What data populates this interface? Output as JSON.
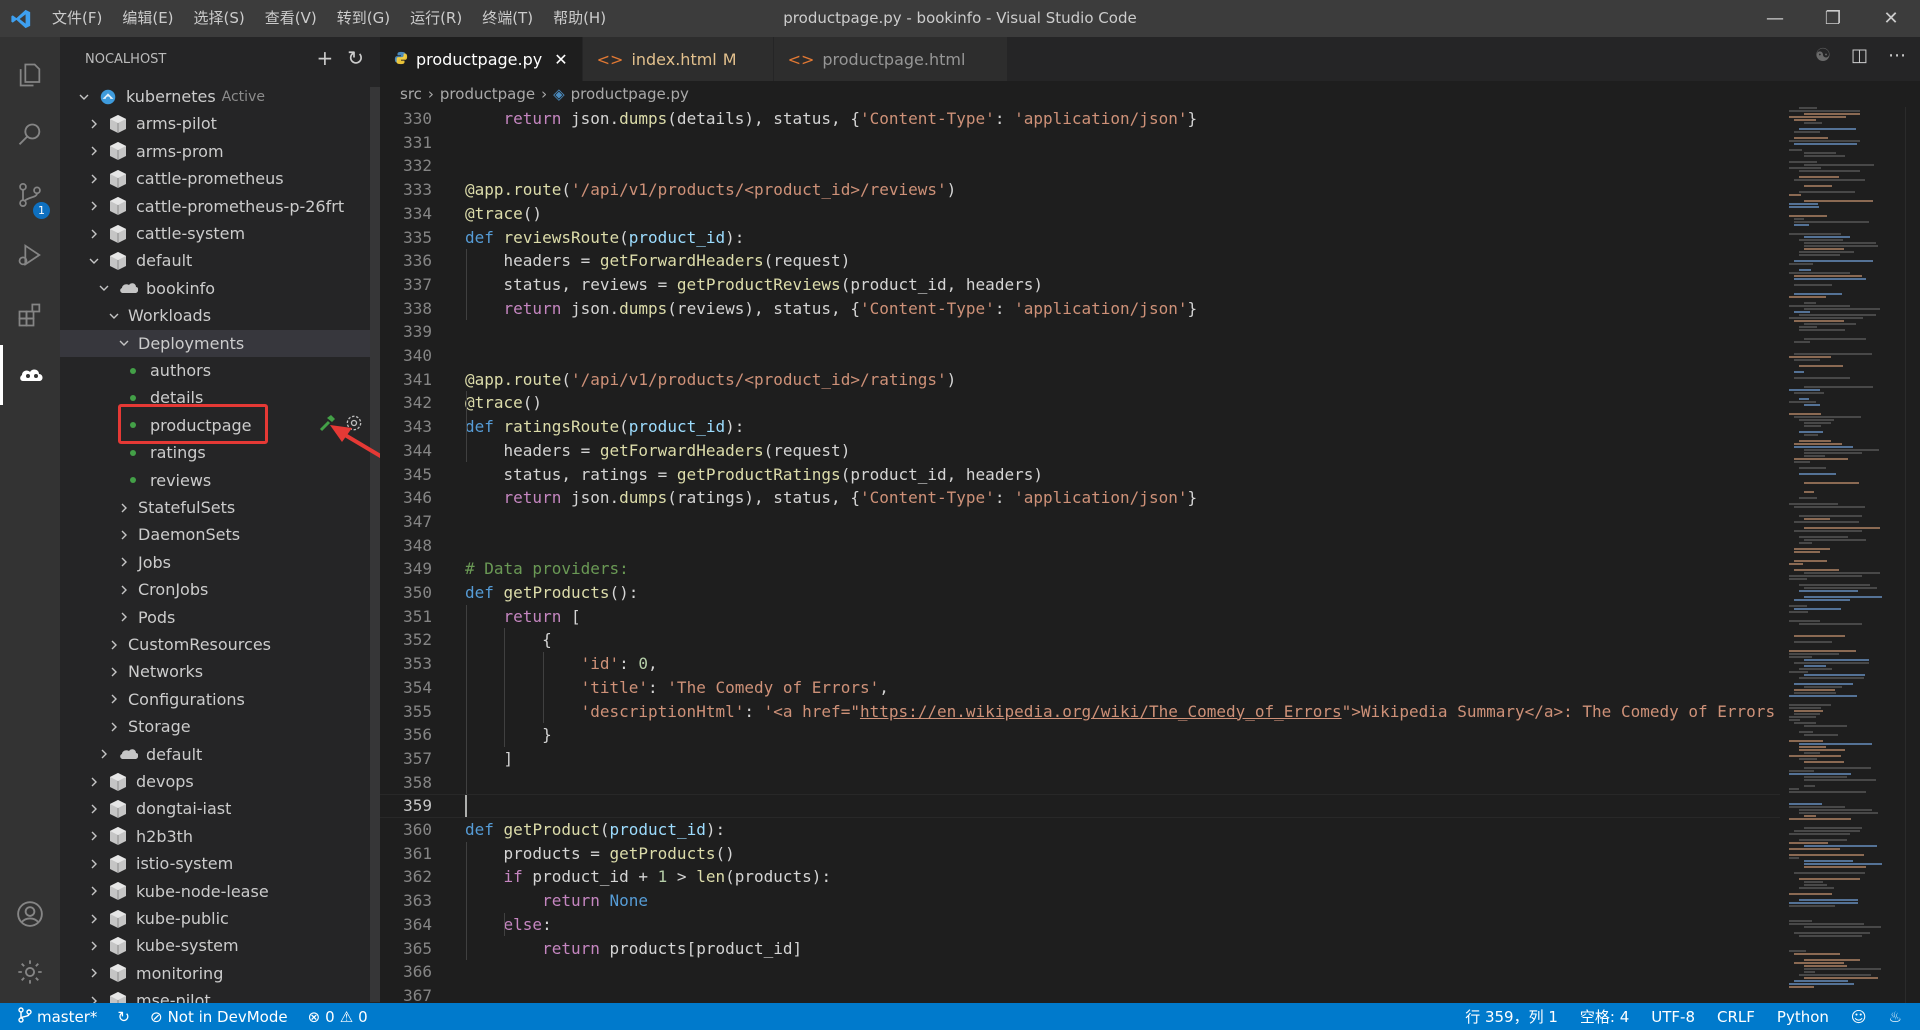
{
  "titlebar": {
    "menu": [
      "文件(F)",
      "编辑(E)",
      "选择(S)",
      "查看(V)",
      "转到(G)",
      "运行(R)",
      "终端(T)",
      "帮助(H)"
    ],
    "title": "productpage.py - bookinfo - Visual Studio Code"
  },
  "activity": {
    "scm_badge": "1"
  },
  "sidebar": {
    "header": "NOCALHOST",
    "tree": {
      "root_label": "kubernetes",
      "root_status": "Active",
      "namespaces_top": [
        "arms-pilot",
        "arms-prom",
        "cattle-prometheus",
        "cattle-prometheus-p-26frt",
        "cattle-system",
        "default"
      ],
      "app": "bookinfo",
      "workloads": "Workloads",
      "deployments": "Deployments",
      "deployment_items": [
        "authors",
        "details",
        "productpage",
        "ratings",
        "reviews"
      ],
      "workload_groups": [
        "StatefulSets",
        "DaemonSets",
        "Jobs",
        "CronJobs",
        "Pods"
      ],
      "resource_groups": [
        "CustomResources",
        "Networks",
        "Configurations",
        "Storage"
      ],
      "default_app": "default",
      "namespaces_bottom": [
        "devops",
        "dongtai-iast",
        "h2b3th",
        "istio-system",
        "kube-node-lease",
        "kube-public",
        "kube-system",
        "monitoring",
        "mse-pilot"
      ]
    }
  },
  "tabs": [
    {
      "label": "productpage.py",
      "status": "",
      "active": true
    },
    {
      "label": "index.html",
      "status": "M",
      "active": false
    },
    {
      "label": "productpage.html",
      "status": "",
      "active": false
    }
  ],
  "breadcrumb": [
    "src",
    "productpage",
    "productpage.py"
  ],
  "editor": {
    "current_line": 359,
    "lines": [
      {
        "n": "330",
        "html": "    <span class=\"kw2\">return</span> json.<span class=\"fn\">dumps</span>(details), status, {<span class=\"str\">'Content-Type'</span>: <span class=\"str\">'application/json'</span>}"
      },
      {
        "n": "331",
        "html": ""
      },
      {
        "n": "332",
        "html": ""
      },
      {
        "n": "333",
        "html": "<span class=\"dec\">@app.route</span>(<span class=\"str\">'/api/v1/products/&lt;product_id&gt;/reviews'</span>)"
      },
      {
        "n": "334",
        "html": "<span class=\"dec\">@trace</span>()"
      },
      {
        "n": "335",
        "html": "<span class=\"kw\">def</span> <span class=\"fn\">reviewsRoute</span>(<span class=\"var\">product_id</span>):"
      },
      {
        "n": "336",
        "html": "    headers = <span class=\"fn\">getForwardHeaders</span>(request)"
      },
      {
        "n": "337",
        "html": "    status, reviews = <span class=\"fn\">getProductReviews</span>(product_id, headers)"
      },
      {
        "n": "338",
        "html": "    <span class=\"kw2\">return</span> json.<span class=\"fn\">dumps</span>(reviews), status, {<span class=\"str\">'Content-Type'</span>: <span class=\"str\">'application/json'</span>}"
      },
      {
        "n": "339",
        "html": ""
      },
      {
        "n": "340",
        "html": ""
      },
      {
        "n": "341",
        "html": "<span class=\"dec\">@app.route</span>(<span class=\"str\">'/api/v1/products/&lt;product_id&gt;/ratings'</span>)"
      },
      {
        "n": "342",
        "html": "<span class=\"dec\">@trace</span>()"
      },
      {
        "n": "343",
        "html": "<span class=\"kw\">def</span> <span class=\"fn\">ratingsRoute</span>(<span class=\"var\">product_id</span>):"
      },
      {
        "n": "344",
        "html": "    headers = <span class=\"fn\">getForwardHeaders</span>(request)"
      },
      {
        "n": "345",
        "html": "    status, ratings = <span class=\"fn\">getProductRatings</span>(product_id, headers)"
      },
      {
        "n": "346",
        "html": "    <span class=\"kw2\">return</span> json.<span class=\"fn\">dumps</span>(ratings), status, {<span class=\"str\">'Content-Type'</span>: <span class=\"str\">'application/json'</span>}"
      },
      {
        "n": "347",
        "html": ""
      },
      {
        "n": "348",
        "html": ""
      },
      {
        "n": "349",
        "html": "<span class=\"cm\"># Data providers:</span>"
      },
      {
        "n": "350",
        "html": "<span class=\"kw\">def</span> <span class=\"fn\">getProducts</span>():"
      },
      {
        "n": "351",
        "html": "    <span class=\"kw2\">return</span> ["
      },
      {
        "n": "352",
        "html": "        {"
      },
      {
        "n": "353",
        "html": "            <span class=\"str\">'id'</span>: <span class=\"num\">0</span>,"
      },
      {
        "n": "354",
        "html": "            <span class=\"str\">'title'</span>: <span class=\"str\">'The Comedy of Errors'</span>,"
      },
      {
        "n": "355",
        "html": "            <span class=\"str\">'descriptionHtml'</span>: <span class=\"str\">'&lt;a href=\"<span class=\"url\">https://en.wikipedia.org/wiki/The_Comedy_of_Errors</span>\"&gt;Wikipedia Summary&lt;/a&gt;: The Comedy of Errors</span>"
      },
      {
        "n": "356",
        "html": "        }"
      },
      {
        "n": "357",
        "html": "    ]"
      },
      {
        "n": "358",
        "html": ""
      },
      {
        "n": "359",
        "html": ""
      },
      {
        "n": "360",
        "html": "<span class=\"kw\">def</span> <span class=\"fn\">getProduct</span>(<span class=\"var\">product_id</span>):"
      },
      {
        "n": "361",
        "html": "    products = <span class=\"fn\">getProducts</span>()"
      },
      {
        "n": "362",
        "html": "    <span class=\"kw2\">if</span> product_id + <span class=\"num\">1</span> &gt; <span class=\"fn\">len</span>(products):"
      },
      {
        "n": "363",
        "html": "        <span class=\"kw2\">return</span> <span class=\"kw\">None</span>"
      },
      {
        "n": "364",
        "html": "    <span class=\"kw2\">else</span>:"
      },
      {
        "n": "365",
        "html": "        <span class=\"kw2\">return</span> products[product_id]"
      },
      {
        "n": "366",
        "html": ""
      },
      {
        "n": "367",
        "html": ""
      }
    ]
  },
  "statusbar": {
    "branch": "master*",
    "devmode": "Not in DevMode",
    "errors": "0",
    "warnings": "0",
    "position": "行 359，列 1",
    "indent": "空格: 4",
    "encoding": "UTF-8",
    "eol": "CRLF",
    "language": "Python"
  },
  "colors": {
    "accent": "#007acc",
    "highlight_box": "#e53935",
    "running_dot": "#43a047"
  }
}
